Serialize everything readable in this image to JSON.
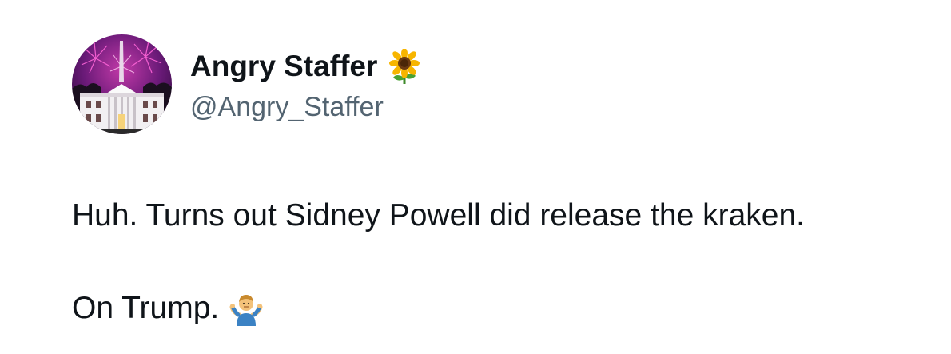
{
  "tweet": {
    "author": {
      "display_name": "Angry Staffer",
      "handle": "@Angry_Staffer",
      "name_emoji": "sunflower-icon",
      "avatar": "white-house-fireworks-avatar"
    },
    "text_lines": [
      "Huh. Turns out Sidney Powell did release the kraken.",
      "On Trump."
    ],
    "trailing_emoji": "man-shrugging-icon"
  },
  "colors": {
    "text": "#0f1419",
    "handle": "#536471",
    "background": "#ffffff"
  }
}
